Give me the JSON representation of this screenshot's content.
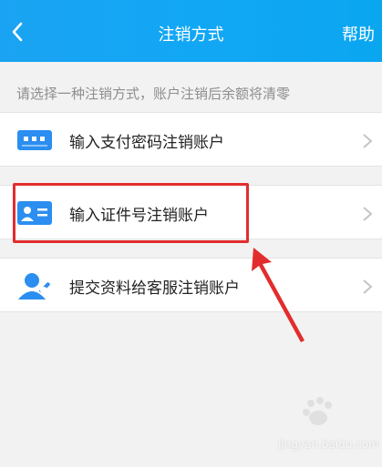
{
  "header": {
    "title": "注销方式",
    "help_label": "帮助",
    "back_icon": "chevron-left-icon",
    "background": "#12a7f5"
  },
  "hint_text": "请选择一种注销方式，账户注销后余额将清零",
  "options": [
    {
      "label": "输入支付密码注销账户",
      "icon": "keypad-icon"
    },
    {
      "label": "输入证件号注销账户",
      "icon": "id-card-icon"
    },
    {
      "label": "提交资料给客服注销账户",
      "icon": "customer-service-icon"
    }
  ],
  "colors": {
    "accent": "#2b8ef0",
    "highlight": "#e22d2d",
    "background": "#f2f2f2"
  },
  "watermark": {
    "text": "jingyan.baidu.com"
  }
}
